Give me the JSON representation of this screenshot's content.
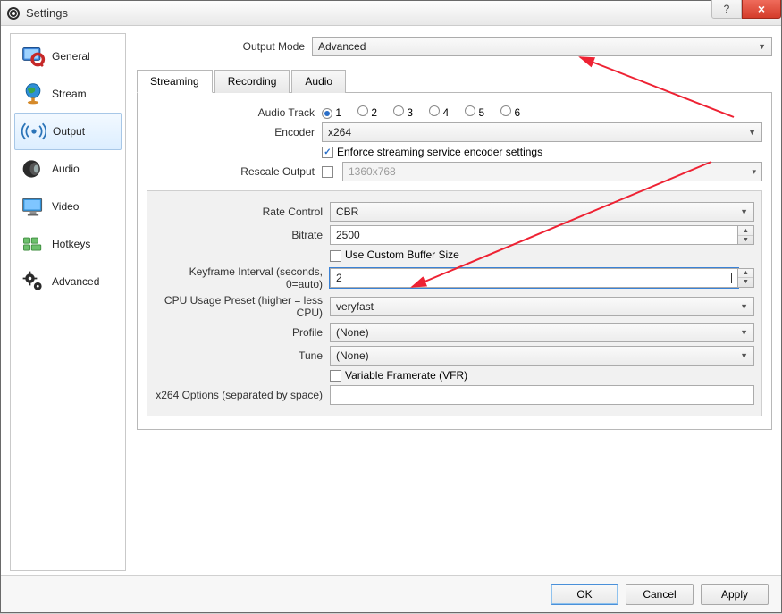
{
  "window": {
    "title": "Settings"
  },
  "sidebar": {
    "items": [
      {
        "label": "General"
      },
      {
        "label": "Stream"
      },
      {
        "label": "Output"
      },
      {
        "label": "Audio"
      },
      {
        "label": "Video"
      },
      {
        "label": "Hotkeys"
      },
      {
        "label": "Advanced"
      }
    ]
  },
  "output": {
    "output_mode_label": "Output Mode",
    "output_mode_value": "Advanced",
    "tabs": {
      "streaming": "Streaming",
      "recording": "Recording",
      "audio": "Audio"
    },
    "audio_track_label": "Audio Track",
    "audio_tracks": [
      "1",
      "2",
      "3",
      "4",
      "5",
      "6"
    ],
    "audio_track_selected": "1",
    "encoder_label": "Encoder",
    "encoder_value": "x264",
    "enforce_label": "Enforce streaming service encoder settings",
    "rescale_label": "Rescale Output",
    "rescale_value": "1360x768",
    "rate_control_label": "Rate Control",
    "rate_control_value": "CBR",
    "bitrate_label": "Bitrate",
    "bitrate_value": "2500",
    "custom_buffer_label": "Use Custom Buffer Size",
    "keyframe_label": "Keyframe Interval (seconds, 0=auto)",
    "keyframe_value": "2",
    "cpu_preset_label": "CPU Usage Preset (higher = less CPU)",
    "cpu_preset_value": "veryfast",
    "profile_label": "Profile",
    "profile_value": "(None)",
    "tune_label": "Tune",
    "tune_value": "(None)",
    "vfr_label": "Variable Framerate (VFR)",
    "x264_options_label": "x264 Options (separated by space)",
    "x264_options_value": ""
  },
  "footer": {
    "ok": "OK",
    "cancel": "Cancel",
    "apply": "Apply"
  }
}
